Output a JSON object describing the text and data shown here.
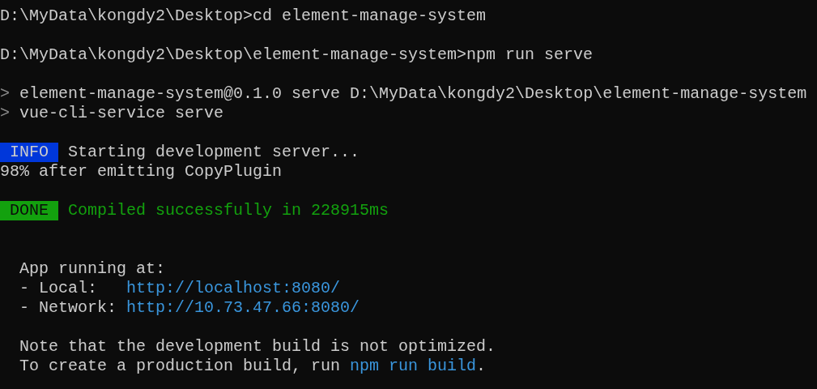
{
  "terminal": {
    "lines": [
      {
        "segments": [
          {
            "kind": "plain",
            "text": "D:\\MyData\\kongdy2\\Desktop>cd element-manage-system"
          }
        ]
      },
      {
        "kind": "blank"
      },
      {
        "segments": [
          {
            "kind": "plain",
            "text": "D:\\MyData\\kongdy2\\Desktop\\element-manage-system>npm run serve"
          }
        ]
      },
      {
        "kind": "blank"
      },
      {
        "segments": [
          {
            "kind": "arrow",
            "text": ">"
          },
          {
            "kind": "plain",
            "text": "element-manage-system@0.1.0 serve D:\\MyData\\kongdy2\\Desktop\\element-manage-system"
          }
        ]
      },
      {
        "segments": [
          {
            "kind": "arrow",
            "text": ">"
          },
          {
            "kind": "plain",
            "text": "vue-cli-service serve"
          }
        ]
      },
      {
        "kind": "blank"
      },
      {
        "segments": [
          {
            "kind": "badge-info",
            "text": "INFO"
          },
          {
            "kind": "plain",
            "text": "Starting development server..."
          }
        ]
      },
      {
        "segments": [
          {
            "kind": "plain",
            "text": "98% after emitting CopyPlugin"
          }
        ]
      },
      {
        "kind": "blank"
      },
      {
        "segments": [
          {
            "kind": "badge-done",
            "text": "DONE"
          },
          {
            "kind": "success",
            "text": "Compiled successfully in 228915ms"
          }
        ]
      },
      {
        "kind": "blank"
      },
      {
        "kind": "blank"
      },
      {
        "indented": true,
        "segments": [
          {
            "kind": "plain",
            "text": "App running at:"
          }
        ]
      },
      {
        "indented": true,
        "segments": [
          {
            "kind": "plain",
            "text": "- Local:   "
          },
          {
            "kind": "link",
            "text": "http://localhost:8080/"
          }
        ]
      },
      {
        "indented": true,
        "segments": [
          {
            "kind": "plain",
            "text": "- Network: "
          },
          {
            "kind": "link",
            "text": "http://10.73.47.66:8080/"
          }
        ]
      },
      {
        "kind": "blank"
      },
      {
        "indented": true,
        "segments": [
          {
            "kind": "plain",
            "text": "Note that the development build is not optimized."
          }
        ]
      },
      {
        "indented": true,
        "kind": "sentence",
        "segments": [
          {
            "kind": "plain",
            "text": "To create a production build, run "
          },
          {
            "kind": "link",
            "text": "npm run build"
          },
          {
            "kind": "plain",
            "text": "."
          }
        ]
      }
    ]
  }
}
